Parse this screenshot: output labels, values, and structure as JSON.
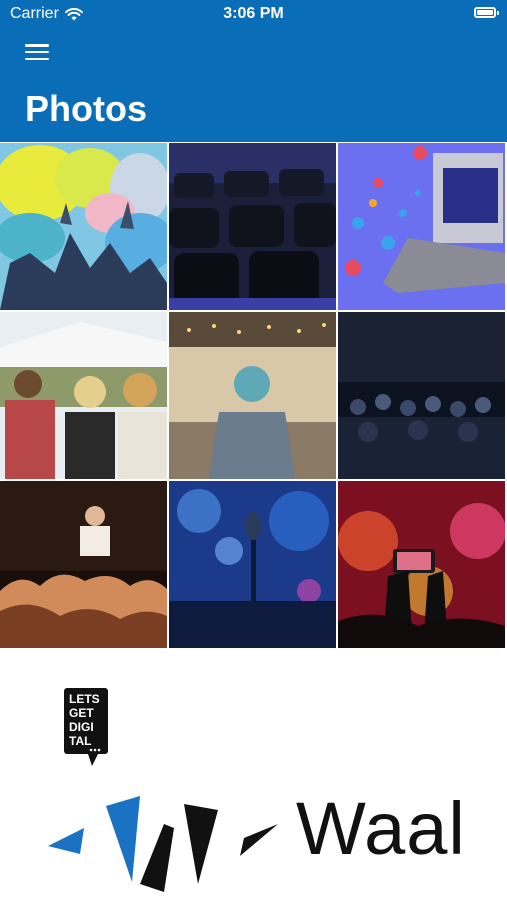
{
  "status_bar": {
    "carrier": "Carrier",
    "time": "3:06 PM"
  },
  "header": {
    "title": "Photos",
    "menu_icon": "hamburger-menu-icon",
    "background_color": "#0a6db8"
  },
  "photos": [
    {
      "subject": "holi-powder-festival-crowd"
    },
    {
      "subject": "empty-auditorium-chairs"
    },
    {
      "subject": "live-stream-reactions-concert-stage"
    },
    {
      "subject": "outdoor-festival-audience-backs"
    },
    {
      "subject": "speaker-on-stage-conference-hall"
    },
    {
      "subject": "seated-audience-dark-hall"
    },
    {
      "subject": "crowd-surfer-concert"
    },
    {
      "subject": "stage-microphone-blue-lights"
    },
    {
      "subject": "phone-filming-concert-red-lights"
    }
  ],
  "footer": {
    "lgd_logo_text": [
      "LETS",
      "GET",
      "DIGI",
      "TAL"
    ],
    "brand_name": "Waal",
    "brand_colors": {
      "blue": "#1a73c2",
      "black": "#111111"
    }
  }
}
